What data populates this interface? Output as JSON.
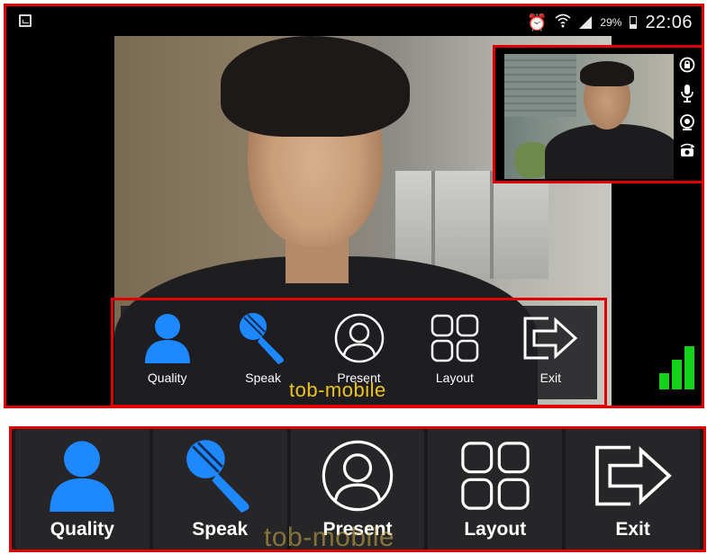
{
  "status_bar": {
    "battery_percent": "29%",
    "time": "22:06",
    "icons": [
      "screenshot-icon",
      "alarm-icon",
      "wifi-icon",
      "signal-icon",
      "battery-icon"
    ]
  },
  "pip_controls": [
    "camera-privacy-icon",
    "microphone-icon",
    "webcam-icon",
    "switch-camera-icon"
  ],
  "toolbar": {
    "items": [
      {
        "label": "Quality",
        "icon": "person-icon"
      },
      {
        "label": "Speak",
        "icon": "microphone-icon"
      },
      {
        "label": "Present",
        "icon": "presenter-icon"
      },
      {
        "label": "Layout",
        "icon": "layout-grid-icon"
      },
      {
        "label": "Exit",
        "icon": "exit-icon"
      }
    ]
  },
  "watermark": "tob-mobile",
  "network_strength": {
    "bars": 3,
    "of": 3
  },
  "colors": {
    "accent_blue": "#1e88ff",
    "highlight_red": "#e00000",
    "signal_green": "#14d31a",
    "watermark_yellow": "#e7c32b"
  }
}
